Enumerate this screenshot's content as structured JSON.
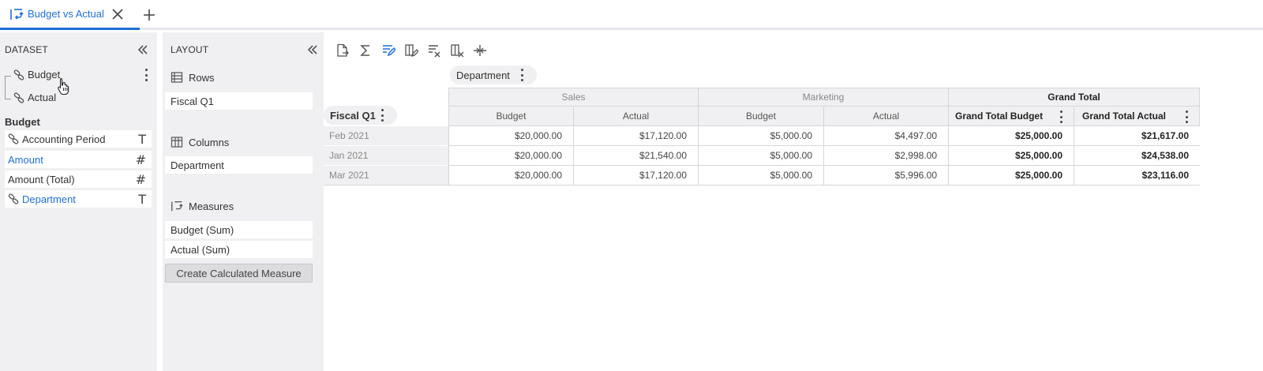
{
  "tab": {
    "title": "Budget vs Actual",
    "icon": "pivot-icon"
  },
  "dataset": {
    "title": "DATASET",
    "sources": [
      {
        "label": "Budget"
      },
      {
        "label": "Actual"
      }
    ],
    "group_label": "Budget",
    "fields": [
      {
        "label": "Accounting Period",
        "type_glyph": "T",
        "linked": true,
        "selected": false
      },
      {
        "label": "Amount",
        "type_glyph": "#",
        "linked": false,
        "selected": true
      },
      {
        "label": "Amount (Total)",
        "type_glyph": "#",
        "linked": false,
        "selected": false
      },
      {
        "label": "Department",
        "type_glyph": "T",
        "linked": true,
        "selected": true
      }
    ]
  },
  "layout": {
    "title": "LAYOUT",
    "rows_label": "Rows",
    "rows": [
      "Fiscal Q1"
    ],
    "columns_label": "Columns",
    "columns": [
      "Department"
    ],
    "measures_label": "Measures",
    "measures": [
      "Budget  (Sum)",
      "Actual  (Sum)"
    ],
    "calc_button": "Create Calculated Measure"
  },
  "toolbar": [
    "export-icon",
    "sum-icon",
    "edit-format-icon",
    "edit-columns-icon",
    "clear-format-icon",
    "clear-columns-icon",
    "collapse-columns-icon"
  ],
  "pivot": {
    "column_dim_chip": "Department",
    "row_dim_chip": "Fiscal Q1",
    "groups": [
      "Sales",
      "Marketing",
      "Grand Total"
    ],
    "subheaders": [
      "Budget",
      "Actual",
      "Budget",
      "Actual",
      "Grand Total Budget",
      "Grand Total Actual"
    ],
    "rows": [
      {
        "label": "Feb 2021",
        "values": [
          "$20,000.00",
          "$17,120.00",
          "$5,000.00",
          "$4,497.00",
          "$25,000.00",
          "$21,617.00"
        ]
      },
      {
        "label": "Jan 2021",
        "values": [
          "$20,000.00",
          "$21,540.00",
          "$5,000.00",
          "$2,998.00",
          "$25,000.00",
          "$24,538.00"
        ]
      },
      {
        "label": "Mar 2021",
        "values": [
          "$20,000.00",
          "$17,120.00",
          "$5,000.00",
          "$5,996.00",
          "$25,000.00",
          "$23,116.00"
        ]
      }
    ]
  },
  "colors": {
    "accent": "#1f6fdb",
    "panel": "#f0f0f2",
    "grid": "#d6d6da"
  }
}
